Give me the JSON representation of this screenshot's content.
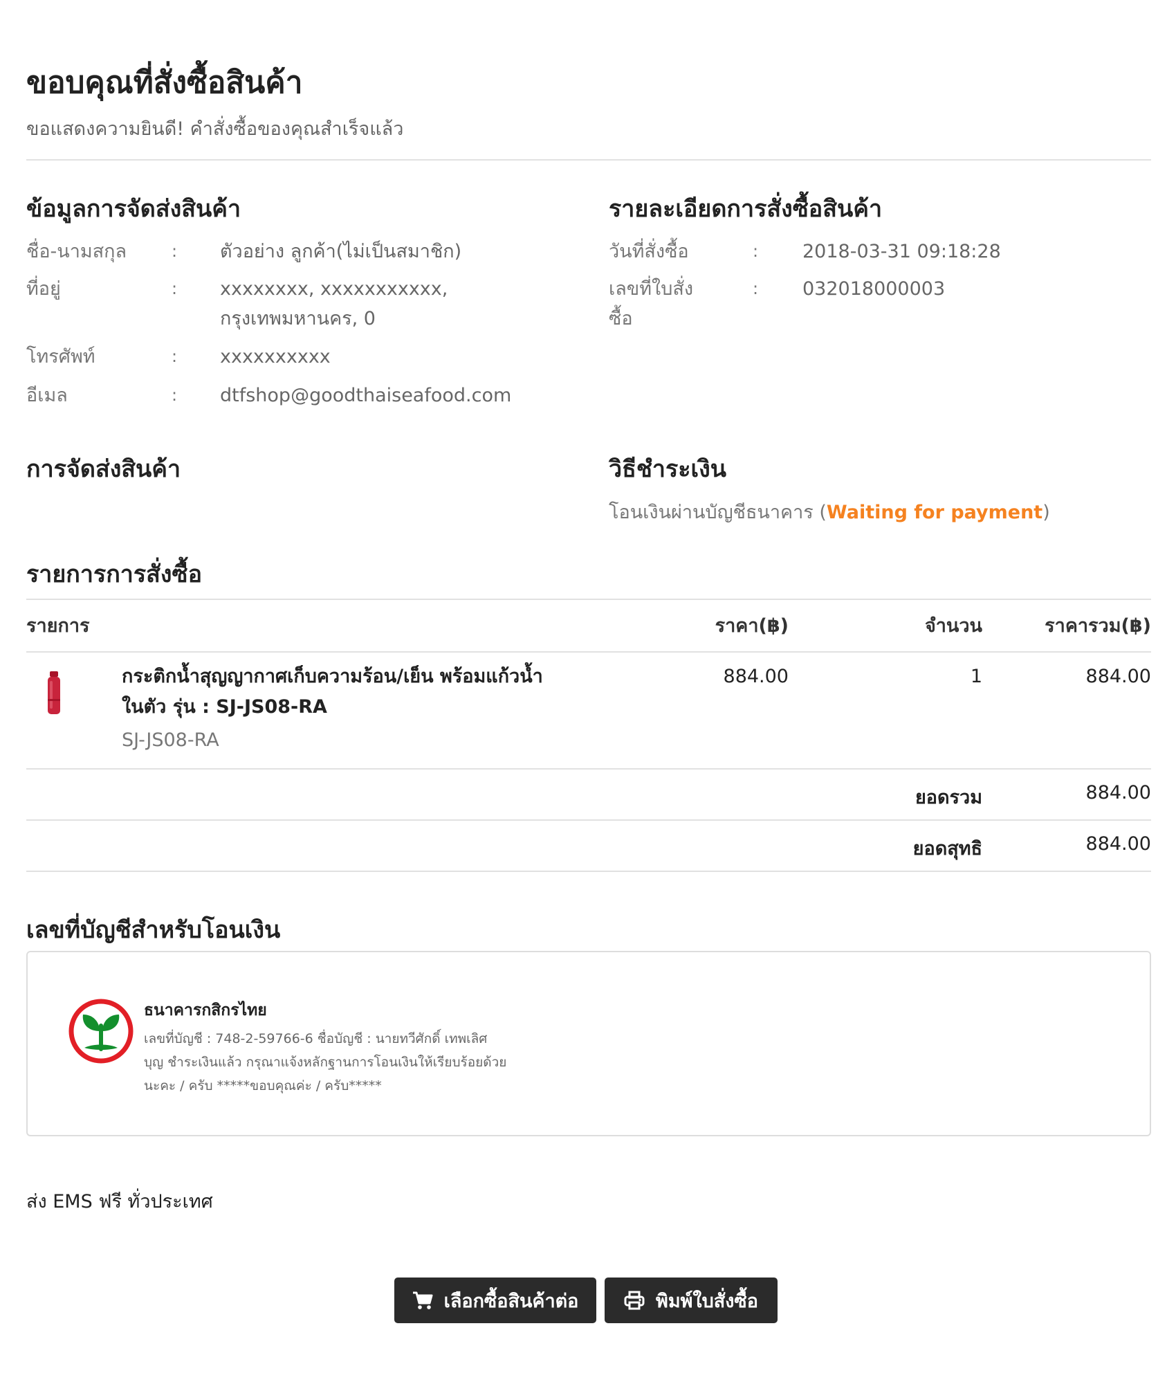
{
  "header": {
    "title": "ขอบคุณที่สั่งซื้อสินค้า",
    "subtitle": "ขอแสดงความยินดี! คำสั่งซื้อของคุณสำเร็จแล้ว"
  },
  "shipping_info": {
    "heading": "ข้อมูลการจัดส่งสินค้า",
    "rows": [
      {
        "label": "ชื่อ-นามสกุล",
        "value": "ตัวอย่าง ลูกค้า(ไม่เป็นสมาชิก)"
      },
      {
        "label": "ที่อยู่",
        "value_line1": "xxxxxxxx, xxxxxxxxxxx,",
        "value_line2": "กรุงเทพมหานคร, 0"
      },
      {
        "label": "โทรศัพท์",
        "value": "xxxxxxxxxx"
      },
      {
        "label": "อีเมล",
        "value": "dtfshop@goodthaiseafood.com"
      }
    ],
    "separator": ":"
  },
  "order_details": {
    "heading": "รายละเอียดการสั่งซื้อสินค้า",
    "rows": [
      {
        "label": "วันที่สั่งซื้อ",
        "value": "2018-03-31 09:18:28"
      },
      {
        "label_line1": "เลขที่ใบสั่ง",
        "label_line2": "ซื้อ",
        "value": "032018000003"
      }
    ]
  },
  "delivery": {
    "heading": "การจัดส่งสินค้า"
  },
  "payment": {
    "heading": "วิธีชำระเงิน",
    "method": "โอนเงินผ่านบัญชีธนาคาร",
    "open_paren": " (",
    "status": "Waiting for payment",
    "close_paren": ")",
    "status_color": "#f58220"
  },
  "order_items": {
    "heading": "รายการการสั่งซื้อ",
    "columns": [
      "รายการ",
      "ราคา(฿)",
      "จำนวน",
      "ราคารวม(฿)"
    ],
    "items": [
      {
        "name_line1": "กระติกน้ำสุญญากาศเก็บความร้อน/เย็น พร้อมแก้วน้ำ",
        "name_line2": "ในตัว รุ่น : SJ-JS08-RA",
        "sku": "SJ-JS08-RA",
        "price": "884.00",
        "quantity": "1",
        "total": "884.00"
      }
    ],
    "subtotal_label": "ยอดรวม",
    "subtotal": "884.00",
    "net_label": "ยอดสุทธิ",
    "net": "884.00"
  },
  "bank": {
    "heading": "เลขที่บัญชีสำหรับโอนเงิน",
    "name": "ธนาคารกสิกรไทย",
    "detail_line1": "เลขที่บัญชี : 748-2-59766-6 ชื่อบัญชี : นายทวีศักดิ์ เทพเลิศ",
    "detail_line2": "บุญ ชำระเงินแล้ว กรุณาแจ้งหลักฐานการโอนเงินให้เรียบร้อยด้วย",
    "detail_line3": "นะคะ / ครับ *****ขอบคุณค่ะ / ครับ*****",
    "logo_icon": "kasikorn-bank-logo",
    "brand_color": "#138f2d",
    "ring_color": "#e21f26"
  },
  "shipping_note": "ส่ง EMS ฟรี ทั่วประเทศ",
  "buttons": {
    "continue_shopping": "เลือกซื้อสินค้าต่อ",
    "continue_icon": "shopping-cart-icon",
    "print_order": "พิมพ์ใบสั่งซื้อ",
    "print_icon": "printer-icon"
  }
}
